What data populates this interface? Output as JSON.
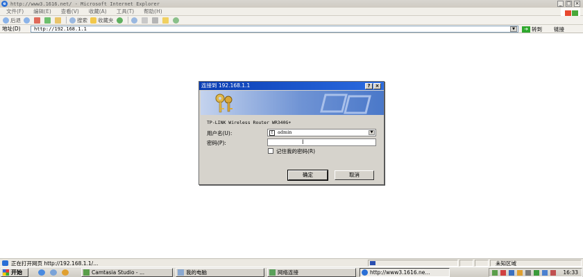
{
  "window": {
    "title": "http://www3.1616.net/ - Microsoft Internet Explorer",
    "ie_icon": "ie-logo-icon"
  },
  "menu": [
    "文件(F)",
    "编辑(E)",
    "查看(V)",
    "收藏(A)",
    "工具(T)",
    "帮助(H)"
  ],
  "toolbar": {
    "back_label": "后退",
    "search_label": "搜索",
    "favorites_label": "收藏夹"
  },
  "address": {
    "label": "地址(D)",
    "value": "http://192.168.1.1",
    "go_label": "转到",
    "links_label": "链接"
  },
  "dialog": {
    "title": "连接到 192.168.1.1",
    "help_glyph": "?",
    "close_glyph": "×",
    "realm": "TP-LINK Wireless Router WR340G+",
    "username_label": "用户名(U):",
    "username_value": "admin",
    "password_label": "密码(P):",
    "remember_label": "记住我的密码(R)",
    "ok_label": "确定",
    "cancel_label": "取消"
  },
  "status": {
    "text": "正在打开网页 http://192.168.1.1/...",
    "zone": "未知区域"
  },
  "taskbar": {
    "start_label": "开始",
    "tasks": [
      {
        "label": "Camtasia Studio - ..."
      },
      {
        "label": "我的电脑"
      },
      {
        "label": "网络连接"
      },
      {
        "label": "http://www3.1616.ne..."
      }
    ],
    "clock": "16:33"
  },
  "colors": {
    "dialog_title": "#0a3db3",
    "taskbar": "#d6d3cc",
    "go_arrow": "#2ea82e"
  }
}
